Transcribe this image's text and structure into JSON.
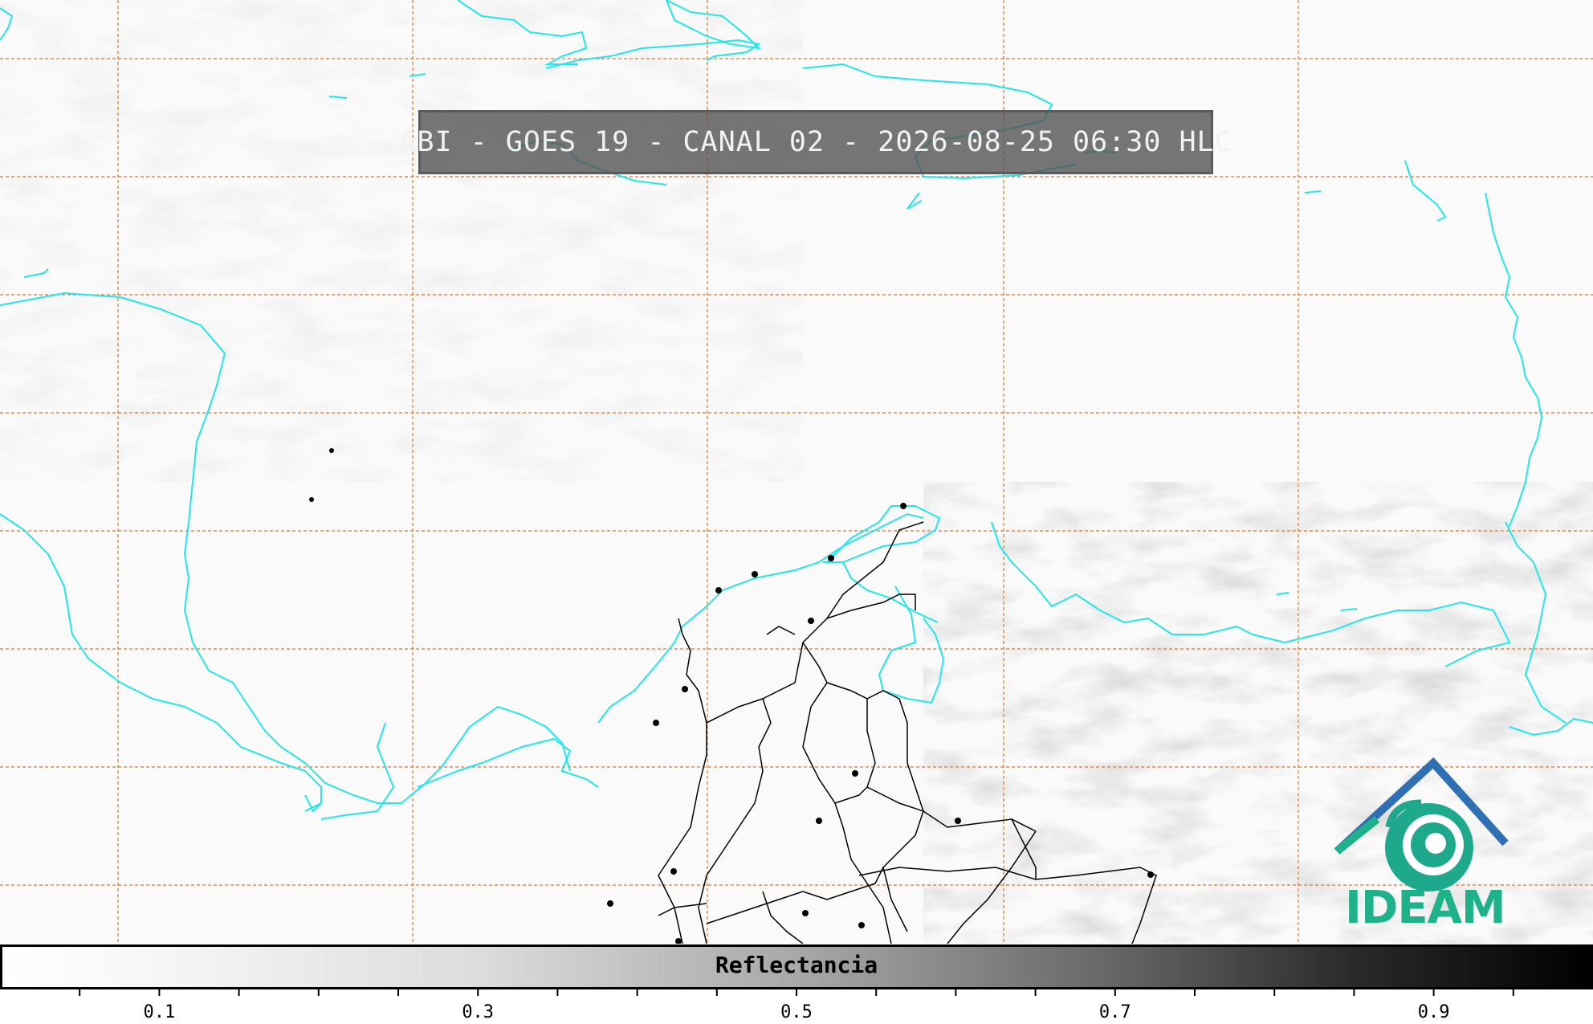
{
  "title": "ABI - GOES 19 - CANAL 02 - 2026-08-25 06:30 HLC",
  "logo": {
    "name": "IDEAM",
    "colors": {
      "blue": "#2f6fb4",
      "green": "#1fb28a"
    }
  },
  "colorbar": {
    "label": "Reflectancia",
    "range": [
      0.0,
      1.0
    ],
    "ticks": [
      "0.1",
      "0.3",
      "0.5",
      "0.7",
      "0.9"
    ],
    "colormap": "white-to-black"
  },
  "colors": {
    "coastline": "#22e6ea",
    "borders": "#000000",
    "grid": "#d9782a"
  }
}
